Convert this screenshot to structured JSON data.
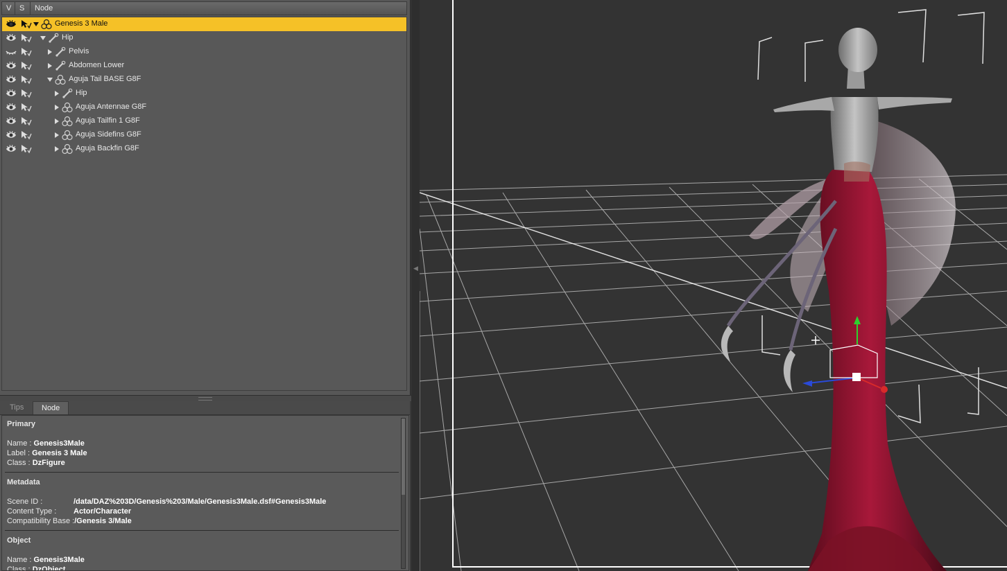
{
  "scene": {
    "columns": {
      "v": "V",
      "s": "S",
      "node": "Node"
    },
    "nodes": [
      {
        "label": "Genesis 3 Male",
        "depth": 0,
        "expanded": true,
        "kind": "figure",
        "selected": true,
        "visible": true
      },
      {
        "label": "Hip",
        "depth": 1,
        "expanded": true,
        "kind": "bone",
        "selected": false,
        "visible": true
      },
      {
        "label": "Pelvis",
        "depth": 2,
        "expanded": false,
        "kind": "bone",
        "selected": false,
        "visible": false
      },
      {
        "label": "Abdomen Lower",
        "depth": 2,
        "expanded": false,
        "kind": "bone",
        "selected": false,
        "visible": true
      },
      {
        "label": "Aguja Tail BASE G8F",
        "depth": 2,
        "expanded": true,
        "kind": "figure",
        "selected": false,
        "visible": true
      },
      {
        "label": "Hip",
        "depth": 3,
        "expanded": false,
        "kind": "bone",
        "selected": false,
        "visible": true
      },
      {
        "label": "Aguja Antennae G8F",
        "depth": 3,
        "expanded": false,
        "kind": "figure",
        "selected": false,
        "visible": true
      },
      {
        "label": "Aguja Tailfin 1 G8F",
        "depth": 3,
        "expanded": false,
        "kind": "figure",
        "selected": false,
        "visible": true
      },
      {
        "label": "Aguja Sidefins G8F",
        "depth": 3,
        "expanded": false,
        "kind": "figure",
        "selected": false,
        "visible": true
      },
      {
        "label": "Aguja Backfin G8F",
        "depth": 3,
        "expanded": false,
        "kind": "figure",
        "selected": false,
        "visible": true
      }
    ]
  },
  "tabs": [
    {
      "label": "Tips",
      "active": false
    },
    {
      "label": "Node",
      "active": true
    }
  ],
  "info": {
    "primary": {
      "title": "Primary",
      "name_key": "Name : ",
      "name_val": "Genesis3Male",
      "label_key": "Label : ",
      "label_val": "Genesis 3 Male",
      "class_key": "Class : ",
      "class_val": "DzFigure"
    },
    "metadata": {
      "title": "Metadata",
      "scene_id_key": "Scene ID :",
      "scene_id_val": "/data/DAZ%203D/Genesis%203/Male/Genesis3Male.dsf#Genesis3Male",
      "content_type_key": "Content Type :",
      "content_type_val": "Actor/Character",
      "compat_key": "Compatibility Base :",
      "compat_val": "/Genesis 3/Male"
    },
    "object": {
      "title": "Object",
      "name_key": "Name : ",
      "name_val": "Genesis3Male",
      "class_key": "Class : ",
      "class_val": "DzObject"
    }
  },
  "colors": {
    "selection": "#f5c127",
    "panel": "#575757",
    "viewport_bg": "#333333",
    "grid": "#d8d8d8",
    "tail_red": "#8c1228",
    "skin_gray": "#9c9c9c"
  },
  "icons": {
    "visible": "eye-icon",
    "hidden": "eye-closed-icon",
    "selectable": "pointer-check-icon",
    "bone": "bone-icon",
    "figure": "figure-icon",
    "expanded": "triangle-down-icon",
    "collapsed": "triangle-right-icon"
  }
}
